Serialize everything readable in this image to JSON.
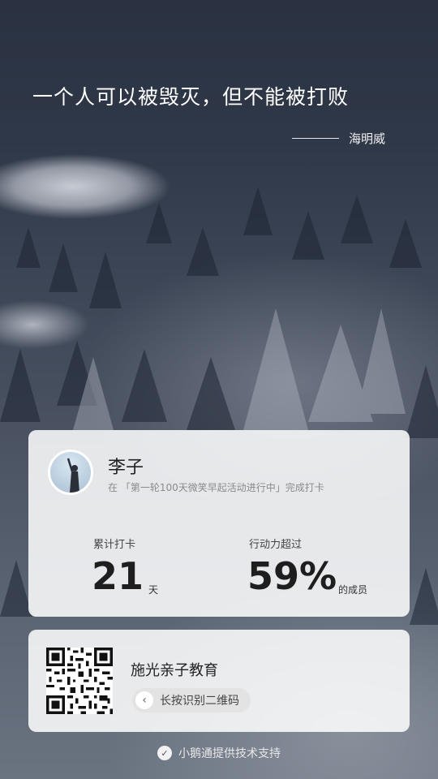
{
  "quote": {
    "text": "一个人可以被毁灭，但不能被打败",
    "author": "海明威"
  },
  "user": {
    "name": "李子",
    "description": "在 「第一轮100天微笑早起活动进行中」完成打卡"
  },
  "stats": {
    "checkin_label": "累计打卡",
    "checkin_value": "21",
    "checkin_unit": "天",
    "action_label": "行动力超过",
    "action_value": "59%",
    "action_unit": "的成员"
  },
  "org": {
    "name": "施光亲子教育",
    "qr_hint": "长按识别二维码"
  },
  "footer": {
    "text": "小鹅通提供技术支持"
  },
  "colors": {
    "card_bg": "#ffffff",
    "text_dark": "#1e1e1e",
    "text_muted": "#8b8b8b"
  }
}
